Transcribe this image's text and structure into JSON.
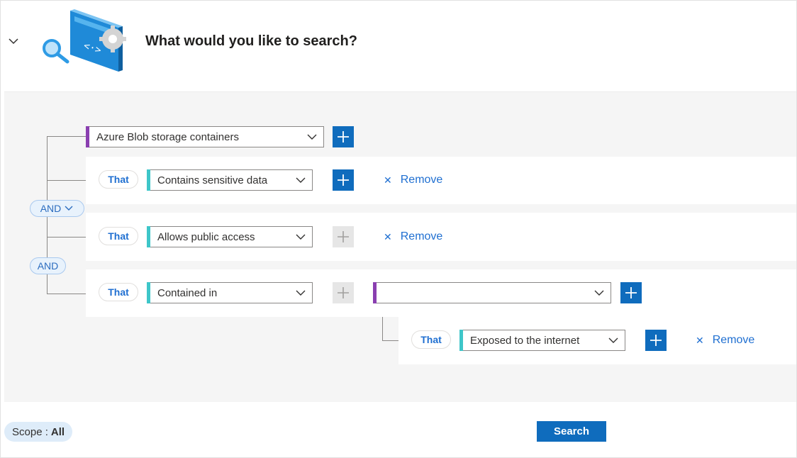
{
  "header": {
    "title": "What would you like to search?",
    "collapse_icon": "chevron-down-icon",
    "illustration_icon": "search-code-illustration"
  },
  "query": {
    "root_dropdown": {
      "value": "Azure Blob storage containers"
    },
    "operators": [
      {
        "label": "AND",
        "has_dropdown": true
      },
      {
        "label": "AND",
        "has_dropdown": false
      }
    ],
    "conditions": [
      {
        "prefix": "That",
        "value": "Contains sensitive data",
        "add_enabled": true,
        "remove_label": "Remove"
      },
      {
        "prefix": "That",
        "value": "Allows public access",
        "add_enabled": false,
        "remove_label": "Remove"
      },
      {
        "prefix": "That",
        "value": "Contained in",
        "add_enabled": false,
        "target_value": ""
      }
    ],
    "nested_condition": {
      "prefix": "That",
      "value": "Exposed to the internet",
      "remove_label": "Remove"
    }
  },
  "footer": {
    "scope_label": "Scope :",
    "scope_value": "All",
    "search_label": "Search"
  },
  "colors": {
    "accent_blue": "#0f6cbd",
    "link_blue": "#1f6fd1",
    "resource_accent": "#8a3fb0",
    "condition_accent": "#3ec6c9"
  }
}
